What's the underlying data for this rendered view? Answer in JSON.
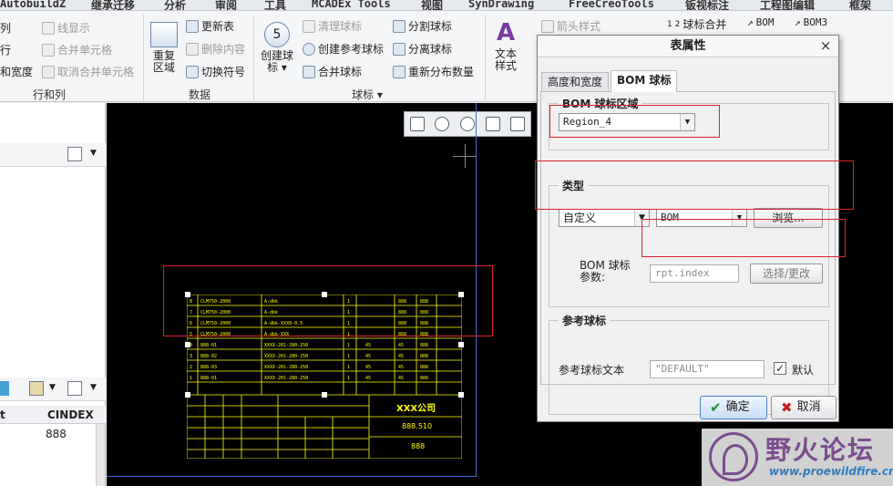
{
  "ribbon": {
    "tabs": [
      "AutobuildZ",
      "继承迁移",
      "分析",
      "审阅",
      "工具",
      "MCADEx Tools",
      "视图",
      "SynDrawing",
      "FreeCreoTools",
      "钣视标注",
      "工程图编辑",
      "框架"
    ],
    "left_clipped_items": [
      "列",
      "行",
      "和宽度"
    ],
    "table_group": {
      "items": [
        "线显示",
        "合并单元格",
        "取消合并单元格"
      ],
      "label": "行和列"
    },
    "data_group": {
      "big_button": "重复\n区域",
      "items": [
        "更新表",
        "删除内容",
        "切换符号"
      ],
      "label": "数据"
    },
    "balloon_group": {
      "big_button": "创建球\n标",
      "items_col1": [
        "清理球标",
        "创建参考球标",
        "合并球标"
      ],
      "items_col2": [
        "分割球标",
        "分离球标",
        "重新分布数量"
      ],
      "label": "球标"
    },
    "text_group": {
      "big_button": "文本\n样式",
      "items": [
        "箭头样式"
      ]
    },
    "right_items": [
      "球标合并",
      "BOM",
      "BOM3"
    ]
  },
  "left_panel": {
    "columns": [
      "t",
      "CINDEX"
    ],
    "cell_value": "888"
  },
  "drawing": {
    "company": "XXX公司",
    "part_code": "888.510",
    "part_code_bottom": "888"
  },
  "dialog": {
    "title": "表属性",
    "tabs": [
      "高度和宽度",
      "BOM 球标"
    ],
    "region": {
      "legend": "BOM 球标区域",
      "selected": "Region_4"
    },
    "type": {
      "legend": "类型",
      "type_value": "自定义",
      "bom_value": "BOM",
      "browse_label": "浏览..."
    },
    "param": {
      "label": "BOM 球标\n参数:",
      "value": "rpt.index",
      "select_label": "选择/更改"
    },
    "reference": {
      "legend": "参考球标",
      "label": "参考球标文本",
      "value": "\"DEFAULT\"",
      "default_label": "默认",
      "default_checked": true
    },
    "ok_label": "确定",
    "cancel_label": "取消"
  },
  "watermark": {
    "name": "野火论坛",
    "url": "www.proewildfire.cn"
  },
  "colors": {
    "canvas": "#000000",
    "drawing_lines": "#ffff00",
    "highlight": "#d8252b",
    "sheet_border": "#3a6ad8"
  }
}
